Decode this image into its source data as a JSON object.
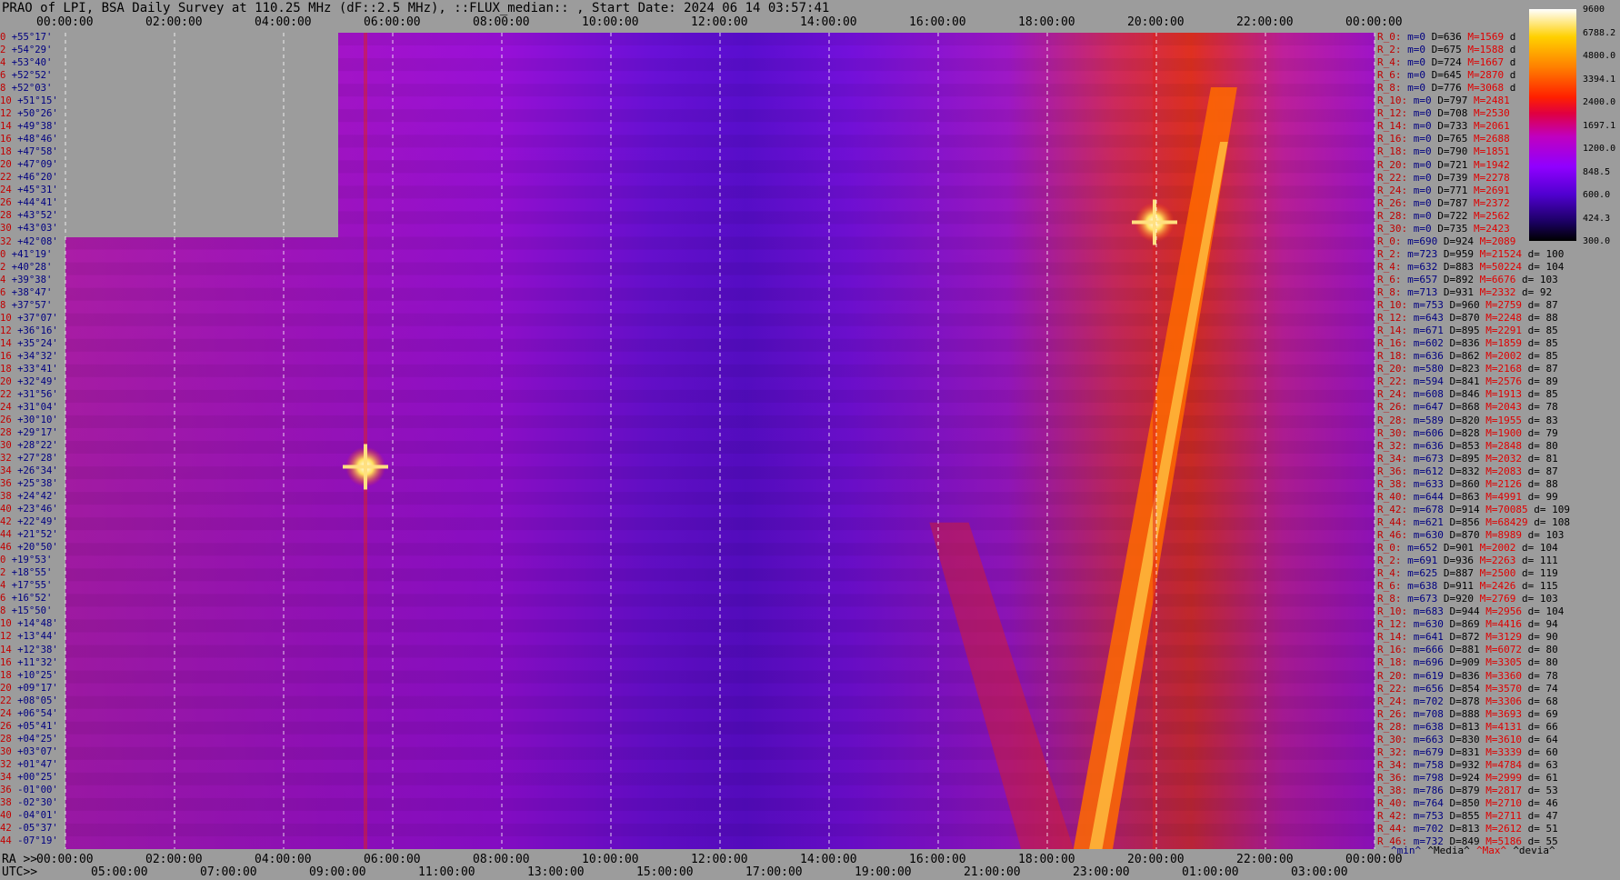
{
  "title": "PRAO of LPI, BSA Daily Survey at 110.25 MHz (dF::2.5 MHz), ::FLUX_median:: , Start Date: 2024 06 14 03:57:41",
  "chart_data": {
    "type": "heatmap",
    "title": "PRAO of LPI, BSA Daily Survey at 110.25 MHz (dF::2.5 MHz), ::FLUX_median:: , Start Date: 2024 06 14 03:57:41",
    "x_top_ticks": [
      "00:00:00",
      "02:00:00",
      "04:00:00",
      "06:00:00",
      "08:00:00",
      "10:00:00",
      "12:00:00",
      "14:00:00",
      "16:00:00",
      "18:00:00",
      "20:00:00",
      "22:00:00",
      "00:00:00"
    ],
    "x_bottom_ra_label": "RA >>",
    "x_bottom_ra_ticks": [
      "00:00:00",
      "02:00:00",
      "04:00:00",
      "06:00:00",
      "08:00:00",
      "10:00:00",
      "12:00:00",
      "14:00:00",
      "16:00:00",
      "18:00:00",
      "20:00:00",
      "22:00:00",
      "00:00:00"
    ],
    "x_bottom_utc_label": "UTC>>",
    "x_bottom_utc_ticks": [
      "05:00:00",
      "07:00:00",
      "09:00:00",
      "11:00:00",
      "13:00:00",
      "15:00:00",
      "17:00:00",
      "19:00:00",
      "21:00:00",
      "23:00:00",
      "01:00:00",
      "03:00:00"
    ],
    "declinations": [
      {
        "r": "0",
        "v": "+55°17'"
      },
      {
        "r": "2",
        "v": "+54°29'"
      },
      {
        "r": "4",
        "v": "+53°40'"
      },
      {
        "r": "6",
        "v": "+52°52'"
      },
      {
        "r": "8",
        "v": "+52°03'"
      },
      {
        "r": "10",
        "v": "+51°15'"
      },
      {
        "r": "12",
        "v": "+50°26'"
      },
      {
        "r": "14",
        "v": "+49°38'"
      },
      {
        "r": "16",
        "v": "+48°46'"
      },
      {
        "r": "18",
        "v": "+47°58'"
      },
      {
        "r": "20",
        "v": "+47°09'"
      },
      {
        "r": "22",
        "v": "+46°20'"
      },
      {
        "r": "24",
        "v": "+45°31'"
      },
      {
        "r": "26",
        "v": "+44°41'"
      },
      {
        "r": "28",
        "v": "+43°52'"
      },
      {
        "r": "30",
        "v": "+43°03'"
      },
      {
        "r": "32",
        "v": "+42°08'"
      },
      {
        "r": "0",
        "v": "+41°19'"
      },
      {
        "r": "2",
        "v": "+40°28'"
      },
      {
        "r": "4",
        "v": "+39°38'"
      },
      {
        "r": "6",
        "v": "+38°47'"
      },
      {
        "r": "8",
        "v": "+37°57'"
      },
      {
        "r": "10",
        "v": "+37°07'"
      },
      {
        "r": "12",
        "v": "+36°16'"
      },
      {
        "r": "14",
        "v": "+35°24'"
      },
      {
        "r": "16",
        "v": "+34°32'"
      },
      {
        "r": "18",
        "v": "+33°41'"
      },
      {
        "r": "20",
        "v": "+32°49'"
      },
      {
        "r": "22",
        "v": "+31°56'"
      },
      {
        "r": "24",
        "v": "+31°04'"
      },
      {
        "r": "26",
        "v": "+30°10'"
      },
      {
        "r": "28",
        "v": "+29°17'"
      },
      {
        "r": "30",
        "v": "+28°22'"
      },
      {
        "r": "32",
        "v": "+27°28'"
      },
      {
        "r": "34",
        "v": "+26°34'"
      },
      {
        "r": "36",
        "v": "+25°38'"
      },
      {
        "r": "38",
        "v": "+24°42'"
      },
      {
        "r": "40",
        "v": "+23°46'"
      },
      {
        "r": "42",
        "v": "+22°49'"
      },
      {
        "r": "44",
        "v": "+21°52'"
      },
      {
        "r": "46",
        "v": "+20°50'"
      },
      {
        "r": "0",
        "v": "+19°53'"
      },
      {
        "r": "2",
        "v": "+18°55'"
      },
      {
        "r": "4",
        "v": "+17°55'"
      },
      {
        "r": "6",
        "v": "+16°52'"
      },
      {
        "r": "8",
        "v": "+15°50'"
      },
      {
        "r": "10",
        "v": "+14°48'"
      },
      {
        "r": "12",
        "v": "+13°44'"
      },
      {
        "r": "14",
        "v": "+12°38'"
      },
      {
        "r": "16",
        "v": "+11°32'"
      },
      {
        "r": "18",
        "v": "+10°25'"
      },
      {
        "r": "20",
        "v": "+09°17'"
      },
      {
        "r": "22",
        "v": "+08°05'"
      },
      {
        "r": "24",
        "v": "+06°54'"
      },
      {
        "r": "26",
        "v": "+05°41'"
      },
      {
        "r": "28",
        "v": "+04°25'"
      },
      {
        "r": "30",
        "v": "+03°07'"
      },
      {
        "r": "32",
        "v": "+01°47'"
      },
      {
        "r": "34",
        "v": "+00°25'"
      },
      {
        "r": "36",
        "v": "-01°00'"
      },
      {
        "r": "38",
        "v": "-02°30'"
      },
      {
        "r": "40",
        "v": "-04°01'"
      },
      {
        "r": "42",
        "v": "-05°37'"
      },
      {
        "r": "44",
        "v": "-07°19'"
      }
    ],
    "colorbar_ticks": [
      "9600",
      "6788.2",
      "4800.0",
      "3394.1",
      "2400.0",
      "1697.1",
      "1200.0",
      "848.5",
      "600.0",
      "424.3",
      "300.0"
    ],
    "colorbar_range": [
      300,
      9600
    ],
    "colorbar_scale": "log",
    "colormap": [
      "#000000",
      "#1a0060",
      "#5000d0",
      "#9000ff",
      "#c000c0",
      "#e00040",
      "#ff2000",
      "#ff8000",
      "#ffd000",
      "#ffffff"
    ],
    "features": [
      {
        "kind": "point_source",
        "ra": "05:30:00",
        "dec": "+22°00'",
        "value": 9600
      },
      {
        "kind": "point_source",
        "ra": "19:58:00",
        "dec": "+40°45'",
        "value": 9600
      },
      {
        "kind": "band",
        "description_ra_start": "17:40:00",
        "ra_end": "21:00:00"
      }
    ],
    "stats_group1": [
      {
        "r": "R_0:",
        "m": "m=0",
        "D": "D=636",
        "M": "M=1569",
        "d": "d"
      },
      {
        "r": "R_2:",
        "m": "m=0",
        "D": "D=675",
        "M": "M=1588",
        "d": "d"
      },
      {
        "r": "R_4:",
        "m": "m=0",
        "D": "D=724",
        "M": "M=1667",
        "d": "d"
      },
      {
        "r": "R_6:",
        "m": "m=0",
        "D": "D=645",
        "M": "M=2870",
        "d": "d"
      },
      {
        "r": "R_8:",
        "m": "m=0",
        "D": "D=776",
        "M": "M=3068",
        "d": "d"
      },
      {
        "r": "R_10:",
        "m": "m=0",
        "D": "D=797",
        "M": "M=2481",
        "d": ""
      },
      {
        "r": "R_12:",
        "m": "m=0",
        "D": "D=708",
        "M": "M=2530",
        "d": ""
      },
      {
        "r": "R_14:",
        "m": "m=0",
        "D": "D=733",
        "M": "M=2061",
        "d": ""
      },
      {
        "r": "R_16:",
        "m": "m=0",
        "D": "D=765",
        "M": "M=2688",
        "d": ""
      },
      {
        "r": "R_18:",
        "m": "m=0",
        "D": "D=790",
        "M": "M=1851",
        "d": ""
      },
      {
        "r": "R_20:",
        "m": "m=0",
        "D": "D=721",
        "M": "M=1942",
        "d": ""
      },
      {
        "r": "R_22:",
        "m": "m=0",
        "D": "D=739",
        "M": "M=2278",
        "d": ""
      },
      {
        "r": "R_24:",
        "m": "m=0",
        "D": "D=771",
        "M": "M=2691",
        "d": ""
      },
      {
        "r": "R_26:",
        "m": "m=0",
        "D": "D=787",
        "M": "M=2372",
        "d": ""
      },
      {
        "r": "R_28:",
        "m": "m=0",
        "D": "D=722",
        "M": "M=2562",
        "d": ""
      },
      {
        "r": "R_30:",
        "m": "m=0",
        "D": "D=735",
        "M": "M=2423",
        "d": ""
      }
    ],
    "stats_group2": [
      {
        "r": "R_0:",
        "m": "m=690",
        "D": "D=924",
        "M": "M=2089",
        "d": ""
      },
      {
        "r": "R_2:",
        "m": "m=723",
        "D": "D=959",
        "M": "M=21524",
        "d": "d= 100"
      },
      {
        "r": "R_4:",
        "m": "m=632",
        "D": "D=883",
        "M": "M=50224",
        "d": "d= 104"
      },
      {
        "r": "R_6:",
        "m": "m=657",
        "D": "D=892",
        "M": "M=6676",
        "d": "d= 103"
      },
      {
        "r": "R_8:",
        "m": "m=713",
        "D": "D=931",
        "M": "M=2332",
        "d": "d= 92"
      },
      {
        "r": "R_10:",
        "m": "m=753",
        "D": "D=960",
        "M": "M=2759",
        "d": "d= 87"
      },
      {
        "r": "R_12:",
        "m": "m=643",
        "D": "D=870",
        "M": "M=2248",
        "d": "d= 88"
      },
      {
        "r": "R_14:",
        "m": "m=671",
        "D": "D=895",
        "M": "M=2291",
        "d": "d= 85"
      },
      {
        "r": "R_16:",
        "m": "m=602",
        "D": "D=836",
        "M": "M=1859",
        "d": "d= 85"
      },
      {
        "r": "R_18:",
        "m": "m=636",
        "D": "D=862",
        "M": "M=2002",
        "d": "d= 85"
      },
      {
        "r": "R_20:",
        "m": "m=580",
        "D": "D=823",
        "M": "M=2168",
        "d": "d= 87"
      },
      {
        "r": "R_22:",
        "m": "m=594",
        "D": "D=841",
        "M": "M=2576",
        "d": "d= 89"
      },
      {
        "r": "R_24:",
        "m": "m=608",
        "D": "D=846",
        "M": "M=1913",
        "d": "d= 85"
      },
      {
        "r": "R_26:",
        "m": "m=647",
        "D": "D=868",
        "M": "M=2043",
        "d": "d= 78"
      },
      {
        "r": "R_28:",
        "m": "m=589",
        "D": "D=820",
        "M": "M=1955",
        "d": "d= 83"
      },
      {
        "r": "R_30:",
        "m": "m=606",
        "D": "D=828",
        "M": "M=1900",
        "d": "d= 79"
      },
      {
        "r": "R_32:",
        "m": "m=636",
        "D": "D=853",
        "M": "M=2848",
        "d": "d= 80"
      },
      {
        "r": "R_34:",
        "m": "m=673",
        "D": "D=895",
        "M": "M=2032",
        "d": "d= 81"
      },
      {
        "r": "R_36:",
        "m": "m=612",
        "D": "D=832",
        "M": "M=2083",
        "d": "d= 87"
      },
      {
        "r": "R_38:",
        "m": "m=633",
        "D": "D=860",
        "M": "M=2126",
        "d": "d= 88"
      },
      {
        "r": "R_40:",
        "m": "m=644",
        "D": "D=863",
        "M": "M=4991",
        "d": "d= 99"
      },
      {
        "r": "R_42:",
        "m": "m=678",
        "D": "D=914",
        "M": "M=70085",
        "d": "d= 109"
      },
      {
        "r": "R_44:",
        "m": "m=621",
        "D": "D=856",
        "M": "M=68429",
        "d": "d= 108"
      },
      {
        "r": "R_46:",
        "m": "m=630",
        "D": "D=870",
        "M": "M=8989",
        "d": "d= 103"
      }
    ],
    "stats_group3": [
      {
        "r": "R_0:",
        "m": "m=652",
        "D": "D=901",
        "M": "M=2002",
        "d": "d= 104"
      },
      {
        "r": "R_2:",
        "m": "m=691",
        "D": "D=936",
        "M": "M=2263",
        "d": "d= 111"
      },
      {
        "r": "R_4:",
        "m": "m=625",
        "D": "D=887",
        "M": "M=2500",
        "d": "d= 119"
      },
      {
        "r": "R_6:",
        "m": "m=638",
        "D": "D=911",
        "M": "M=2426",
        "d": "d= 115"
      },
      {
        "r": "R_8:",
        "m": "m=673",
        "D": "D=920",
        "M": "M=2769",
        "d": "d= 103"
      },
      {
        "r": "R_10:",
        "m": "m=683",
        "D": "D=944",
        "M": "M=2956",
        "d": "d= 104"
      },
      {
        "r": "R_12:",
        "m": "m=630",
        "D": "D=869",
        "M": "M=4416",
        "d": "d= 94"
      },
      {
        "r": "R_14:",
        "m": "m=641",
        "D": "D=872",
        "M": "M=3129",
        "d": "d= 90"
      },
      {
        "r": "R_16:",
        "m": "m=666",
        "D": "D=881",
        "M": "M=6072",
        "d": "d= 80"
      },
      {
        "r": "R_18:",
        "m": "m=696",
        "D": "D=909",
        "M": "M=3305",
        "d": "d= 80"
      },
      {
        "r": "R_20:",
        "m": "m=619",
        "D": "D=836",
        "M": "M=3360",
        "d": "d= 78"
      },
      {
        "r": "R_22:",
        "m": "m=656",
        "D": "D=854",
        "M": "M=3570",
        "d": "d= 74"
      },
      {
        "r": "R_24:",
        "m": "m=702",
        "D": "D=878",
        "M": "M=3306",
        "d": "d= 68"
      },
      {
        "r": "R_26:",
        "m": "m=708",
        "D": "D=888",
        "M": "M=3693",
        "d": "d= 69"
      },
      {
        "r": "R_28:",
        "m": "m=638",
        "D": "D=813",
        "M": "M=4131",
        "d": "d= 66"
      },
      {
        "r": "R_30:",
        "m": "m=663",
        "D": "D=830",
        "M": "M=3610",
        "d": "d= 64"
      },
      {
        "r": "R_32:",
        "m": "m=679",
        "D": "D=831",
        "M": "M=3339",
        "d": "d= 60"
      },
      {
        "r": "R_34:",
        "m": "m=758",
        "D": "D=932",
        "M": "M=4784",
        "d": "d= 63"
      },
      {
        "r": "R_36:",
        "m": "m=798",
        "D": "D=924",
        "M": "M=2999",
        "d": "d= 61"
      },
      {
        "r": "R_38:",
        "m": "m=786",
        "D": "D=879",
        "M": "M=2817",
        "d": "d= 53"
      },
      {
        "r": "R_40:",
        "m": "m=764",
        "D": "D=850",
        "M": "M=2710",
        "d": "d= 46"
      },
      {
        "r": "R_42:",
        "m": "m=753",
        "D": "D=855",
        "M": "M=2711",
        "d": "d= 47"
      },
      {
        "r": "R_44:",
        "m": "m=702",
        "D": "D=813",
        "M": "M=2612",
        "d": "d= 51"
      },
      {
        "r": "R_46:",
        "m": "m=732",
        "D": "D=849",
        "M": "M=5186",
        "d": "d= 55"
      }
    ],
    "legend": {
      "min": "^min^",
      "median": "^Media^",
      "max": "^Max^",
      "devia": "^devia^"
    }
  }
}
